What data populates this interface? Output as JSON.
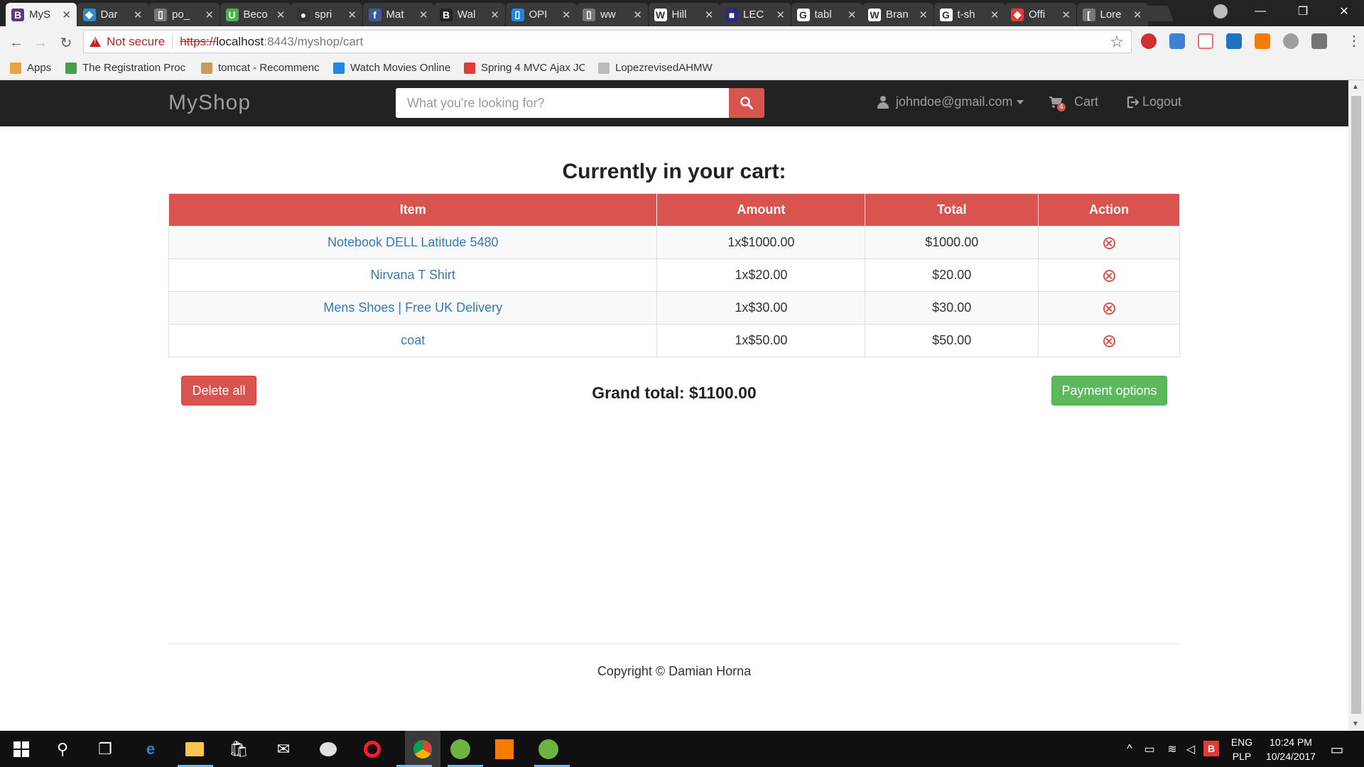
{
  "browser": {
    "tabs": [
      {
        "label": "MyS",
        "icon": "bootstrap-icon",
        "color": "#563d7c",
        "glyph": "B"
      },
      {
        "label": "Dar",
        "icon": "drupal-icon",
        "color": "#2d8cc7",
        "glyph": "◆"
      },
      {
        "label": "po_",
        "icon": "document-icon",
        "color": "#777",
        "glyph": "▯"
      },
      {
        "label": "Beco",
        "icon": "udemy-icon",
        "color": "#4caf50",
        "glyph": "U"
      },
      {
        "label": "spri",
        "icon": "github-icon",
        "color": "#333",
        "glyph": "●"
      },
      {
        "label": "Mat",
        "icon": "facebook-icon",
        "color": "#3b5998",
        "glyph": "f"
      },
      {
        "label": "Wal",
        "icon": "bootstrap-icon",
        "color": "#222",
        "glyph": "B"
      },
      {
        "label": "OPI",
        "icon": "phone-icon",
        "color": "#1e88e5",
        "glyph": "▯"
      },
      {
        "label": "ww",
        "icon": "document-icon",
        "color": "#777",
        "glyph": "▯"
      },
      {
        "label": "Hill",
        "icon": "wikipedia-icon",
        "color": "#fff",
        "glyph": "W"
      },
      {
        "label": "LEC",
        "icon": "lecture-icon",
        "color": "#2a2a80",
        "glyph": "■"
      },
      {
        "label": "tabl",
        "icon": "google-icon",
        "color": "#fff",
        "glyph": "G"
      },
      {
        "label": "Bran",
        "icon": "wikipedia-icon",
        "color": "#fff",
        "glyph": "W"
      },
      {
        "label": "t-sh",
        "icon": "google-icon",
        "color": "#fff",
        "glyph": "G"
      },
      {
        "label": "Offi",
        "icon": "office-icon",
        "color": "#e53935",
        "glyph": "◆"
      },
      {
        "label": "Lore",
        "icon": "document-icon",
        "color": "#777",
        "glyph": "["
      }
    ],
    "active_tab": 0,
    "address": {
      "security": "Not secure",
      "scheme": "https://",
      "host": "localhost",
      "path": ":8443/myshop/cart"
    },
    "bookmarks": [
      {
        "label": "Apps",
        "icon": "apps-grid-icon",
        "color": "#e8a33d"
      },
      {
        "label": "The Registration Proc",
        "icon": "bookmark-green-icon",
        "color": "#43a047"
      },
      {
        "label": "tomcat - Recommenc",
        "icon": "tomcat-icon",
        "color": "#c79b5b"
      },
      {
        "label": "Watch Movies Online",
        "icon": "movies-icon",
        "color": "#1e88e5"
      },
      {
        "label": "Spring 4 MVC Ajax JC",
        "icon": "youtube-icon",
        "color": "#e53935"
      },
      {
        "label": "LopezrevisedAHMW",
        "icon": "document-icon",
        "color": "#bbb"
      }
    ]
  },
  "navbar": {
    "brand": "MyShop",
    "search_placeholder": "What you're looking for?",
    "user": "johndoe@gmail.com",
    "cart_label": "Cart",
    "cart_count": "4",
    "logout_label": "Logout"
  },
  "cart": {
    "title": "Currently in your cart:",
    "headers": [
      "Item",
      "Amount",
      "Total",
      "Action"
    ],
    "rows": [
      {
        "item": "Notebook DELL Latitude 5480",
        "amount": "1x$1000.00",
        "total": "$1000.00"
      },
      {
        "item": "Nirvana T Shirt",
        "amount": "1x$20.00",
        "total": "$20.00"
      },
      {
        "item": "Mens Shoes | Free UK Delivery",
        "amount": "1x$30.00",
        "total": "$30.00"
      },
      {
        "item": "coat",
        "amount": "1x$50.00",
        "total": "$50.00"
      }
    ],
    "delete_all": "Delete all",
    "grand_total": "Grand total: $1100.00",
    "payment": "Payment options"
  },
  "footer": {
    "copyright": "Copyright © Damian Horna"
  },
  "taskbar": {
    "lang": "ENG",
    "lang_sub": "PLP",
    "time": "10:24 PM",
    "date": "10/24/2017"
  },
  "colors": {
    "danger": "#d9534f",
    "success": "#5cb85c",
    "link": "#337ab7",
    "navbar": "#222222"
  }
}
